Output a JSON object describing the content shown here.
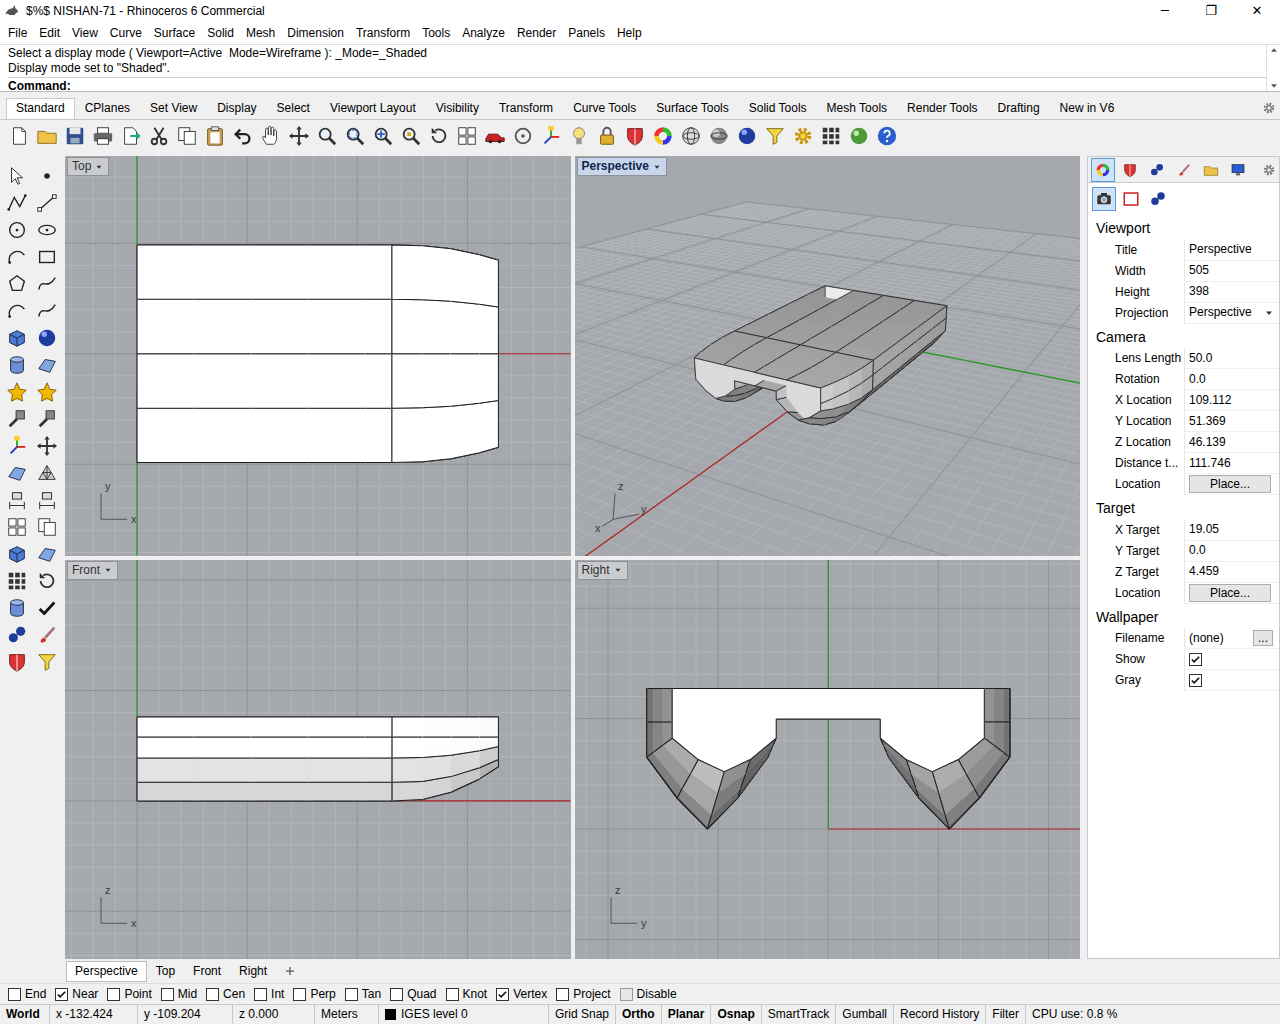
{
  "window": {
    "title": "$%$ NISHAN-71 - Rhinoceros 6 Commercial",
    "controls": [
      "─",
      "❐",
      "✕"
    ]
  },
  "menu": [
    "File",
    "Edit",
    "View",
    "Curve",
    "Surface",
    "Solid",
    "Mesh",
    "Dimension",
    "Transform",
    "Tools",
    "Analyze",
    "Render",
    "Panels",
    "Help"
  ],
  "command": {
    "history": [
      "Select a display mode ( Viewport=Active  Mode=Wireframe ): _Mode=_Shaded",
      "Display mode set to \"Shaded\"."
    ],
    "prompt": "Command:"
  },
  "toolbar_tabs": [
    {
      "label": "Standard",
      "selected": true
    },
    {
      "label": "CPlanes",
      "selected": false
    },
    {
      "label": "Set View",
      "selected": false
    },
    {
      "label": "Display",
      "selected": false
    },
    {
      "label": "Select",
      "selected": false
    },
    {
      "label": "Viewport Layout",
      "selected": false
    },
    {
      "label": "Visibility",
      "selected": false
    },
    {
      "label": "Transform",
      "selected": false
    },
    {
      "label": "Curve Tools",
      "selected": false
    },
    {
      "label": "Surface Tools",
      "selected": false
    },
    {
      "label": "Solid Tools",
      "selected": false
    },
    {
      "label": "Mesh Tools",
      "selected": false
    },
    {
      "label": "Render Tools",
      "selected": false
    },
    {
      "label": "Drafting",
      "selected": false
    },
    {
      "label": "New in V6",
      "selected": false
    }
  ],
  "viewports": [
    {
      "title": "Top",
      "kind": "top",
      "active": false,
      "axes": [
        "y",
        "x"
      ]
    },
    {
      "title": "Perspective",
      "kind": "perspective",
      "active": true,
      "axes": [
        "z",
        "x",
        "y"
      ]
    },
    {
      "title": "Front",
      "kind": "front",
      "active": false,
      "axes": [
        "z",
        "x"
      ]
    },
    {
      "title": "Right",
      "kind": "right",
      "active": false,
      "axes": [
        "z",
        "y"
      ]
    }
  ],
  "viewport_tabs": [
    {
      "label": "Perspective",
      "selected": true
    },
    {
      "label": "Top",
      "selected": false
    },
    {
      "label": "Front",
      "selected": false
    },
    {
      "label": "Right",
      "selected": false
    }
  ],
  "panel_tabs": [
    {
      "selected": true
    },
    {
      "selected": false
    },
    {
      "selected": false
    },
    {
      "selected": false
    },
    {
      "selected": false
    },
    {
      "selected": false
    }
  ],
  "properties": {
    "pages": [
      {
        "selected": true
      },
      {
        "selected": false
      },
      {
        "selected": false
      }
    ],
    "sections": [
      {
        "title": "Viewport",
        "rows": [
          {
            "label": "Title",
            "value": "Perspective",
            "kind": "text"
          },
          {
            "label": "Width",
            "value": "505",
            "kind": "text"
          },
          {
            "label": "Height",
            "value": "398",
            "kind": "text"
          },
          {
            "label": "Projection",
            "value": "Perspective",
            "kind": "select"
          }
        ]
      },
      {
        "title": "Camera",
        "rows": [
          {
            "label": "Lens Length",
            "value": "50.0",
            "kind": "text"
          },
          {
            "label": "Rotation",
            "value": "0.0",
            "kind": "text"
          },
          {
            "label": "X Location",
            "value": "109.112",
            "kind": "text"
          },
          {
            "label": "Y Location",
            "value": "51.369",
            "kind": "text"
          },
          {
            "label": "Z Location",
            "value": "46.139",
            "kind": "text"
          },
          {
            "label": "Distance t...",
            "value": "111.746",
            "kind": "text"
          },
          {
            "label": "Location",
            "value": "Place...",
            "kind": "button"
          }
        ]
      },
      {
        "title": "Target",
        "rows": [
          {
            "label": "X Target",
            "value": "19.05",
            "kind": "text"
          },
          {
            "label": "Y Target",
            "value": "0.0",
            "kind": "text"
          },
          {
            "label": "Z Target",
            "value": "4.459",
            "kind": "text"
          },
          {
            "label": "Location",
            "value": "Place...",
            "kind": "button"
          }
        ]
      },
      {
        "title": "Wallpaper",
        "rows": [
          {
            "label": "Filename",
            "value": "(none)",
            "kind": "file",
            "button": "..."
          },
          {
            "label": "Show",
            "kind": "check",
            "checked": true
          },
          {
            "label": "Gray",
            "kind": "check",
            "checked": true
          }
        ]
      }
    ]
  },
  "osnap": [
    {
      "label": "End",
      "checked": false,
      "disabled": false
    },
    {
      "label": "Near",
      "checked": true,
      "disabled": false
    },
    {
      "label": "Point",
      "checked": false,
      "disabled": false
    },
    {
      "label": "Mid",
      "checked": false,
      "disabled": false
    },
    {
      "label": "Cen",
      "checked": false,
      "disabled": false
    },
    {
      "label": "Int",
      "checked": false,
      "disabled": false
    },
    {
      "label": "Perp",
      "checked": false,
      "disabled": false
    },
    {
      "label": "Tan",
      "checked": false,
      "disabled": false
    },
    {
      "label": "Quad",
      "checked": false,
      "disabled": false
    },
    {
      "label": "Knot",
      "checked": false,
      "disabled": false
    },
    {
      "label": "Vertex",
      "checked": true,
      "disabled": false
    },
    {
      "label": "Project",
      "checked": false,
      "disabled": false
    },
    {
      "label": "Disable",
      "checked": false,
      "disabled": true
    }
  ],
  "status_bar": [
    {
      "text": "World",
      "kind": "cell",
      "on": true
    },
    {
      "text": "x -132.424",
      "kind": "cell",
      "on": false
    },
    {
      "text": "y -109.204",
      "kind": "cell",
      "on": false
    },
    {
      "text": "z 0.000",
      "kind": "cell",
      "on": false
    },
    {
      "text": "Meters",
      "kind": "cell",
      "on": false
    },
    {
      "text": "IGES level 0",
      "kind": "layer",
      "on": false,
      "color": "#000000"
    },
    {
      "text": "Grid Snap",
      "kind": "toggle",
      "on": false
    },
    {
      "text": "Ortho",
      "kind": "toggle",
      "on": true
    },
    {
      "text": "Planar",
      "kind": "toggle",
      "on": true
    },
    {
      "text": "Osnap",
      "kind": "toggle",
      "on": true
    },
    {
      "text": "SmartTrack",
      "kind": "toggle",
      "on": false
    },
    {
      "text": "Gumball",
      "kind": "toggle",
      "on": false
    },
    {
      "text": "Record History",
      "kind": "toggle",
      "on": false
    },
    {
      "text": "Filter",
      "kind": "toggle",
      "on": false
    },
    {
      "text": "CPU use: 0.8 %",
      "kind": "cell",
      "on": false
    }
  ]
}
